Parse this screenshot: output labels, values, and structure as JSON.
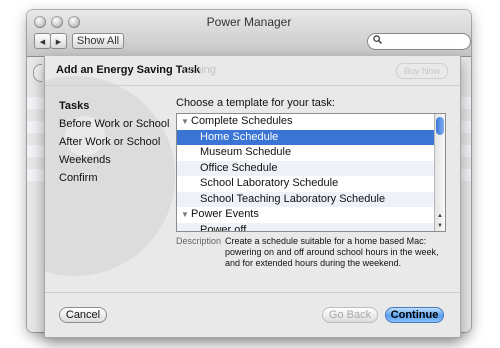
{
  "window": {
    "title": "Power Manager",
    "show_all": "Show All",
    "back_glyph": "◀",
    "forward_glyph": "▶",
    "search_glyph": "🔍"
  },
  "sheet": {
    "title": "Add an Energy Saving Task",
    "ghost_text": "unning",
    "ghost_button": "Buy Now",
    "steps": [
      {
        "label": "Tasks",
        "active": true
      },
      {
        "label": "Before Work or School",
        "active": false
      },
      {
        "label": "After Work or School",
        "active": false
      },
      {
        "label": "Weekends",
        "active": false
      },
      {
        "label": "Confirm",
        "active": false
      }
    ],
    "prompt": "Choose a template for your task:",
    "templates": [
      {
        "label": "Complete Schedules",
        "type": "group"
      },
      {
        "label": "Home Schedule",
        "type": "item",
        "selected": true
      },
      {
        "label": "Museum Schedule",
        "type": "item"
      },
      {
        "label": "Office Schedule",
        "type": "item"
      },
      {
        "label": "School Laboratory Schedule",
        "type": "item"
      },
      {
        "label": "School Teaching Laboratory Schedule",
        "type": "item"
      },
      {
        "label": "Power Events",
        "type": "group"
      },
      {
        "label": "Power off",
        "type": "item"
      }
    ],
    "description_label": "Description",
    "description": "Create a schedule suitable for a home based Mac: powering on and off around school hours in the week, and for extended hours during the weekend.",
    "buttons": {
      "cancel": "Cancel",
      "go_back": "Go Back",
      "continue": "Continue"
    },
    "colors": {
      "selection": "#3a75d6",
      "default_button": "#5a9ff0"
    }
  }
}
